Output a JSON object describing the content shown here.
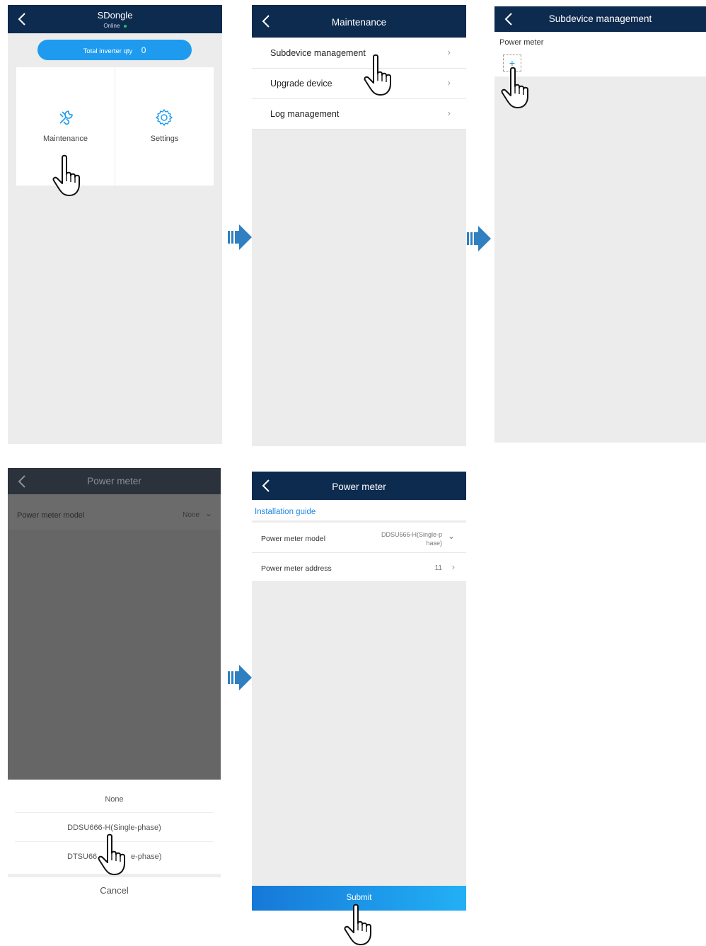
{
  "screen1": {
    "title": "SDongle",
    "status": "Online",
    "status_color": "#22c55e",
    "pill_label": "Total inverter qty",
    "pill_value": "0",
    "tiles": [
      {
        "label": "Maintenance",
        "icon": "wrench-icon"
      },
      {
        "label": "Settings",
        "icon": "gear-icon"
      }
    ]
  },
  "screen2": {
    "title": "Maintenance",
    "items": [
      {
        "label": "Subdevice management"
      },
      {
        "label": "Upgrade device"
      },
      {
        "label": "Log management"
      }
    ]
  },
  "screen3": {
    "title": "Subdevice management",
    "section_label": "Power meter",
    "add_symbol": "+"
  },
  "screen4": {
    "title": "Power meter",
    "field_label": "Power meter model",
    "field_value": "None",
    "options": [
      "None",
      "DDSU666-H(Single-phase)",
      "DTSU666-H(Three-phase)"
    ],
    "option_visible_left": "DTSU66",
    "option_visible_right": "e-phase)",
    "cancel_label": "Cancel"
  },
  "screen5": {
    "title": "Power meter",
    "guide_link": "Installation guide",
    "model_label": "Power meter model",
    "model_value_line1": "DDSU666-H(Single-p",
    "model_value_line2": "hase)",
    "address_label": "Power meter address",
    "address_value": "11",
    "submit_label": "Submit"
  },
  "colors": {
    "header": "#0d2a4f",
    "accent": "#1e9bef",
    "arrow": "#2f7fc1",
    "link": "#1e88e5"
  }
}
